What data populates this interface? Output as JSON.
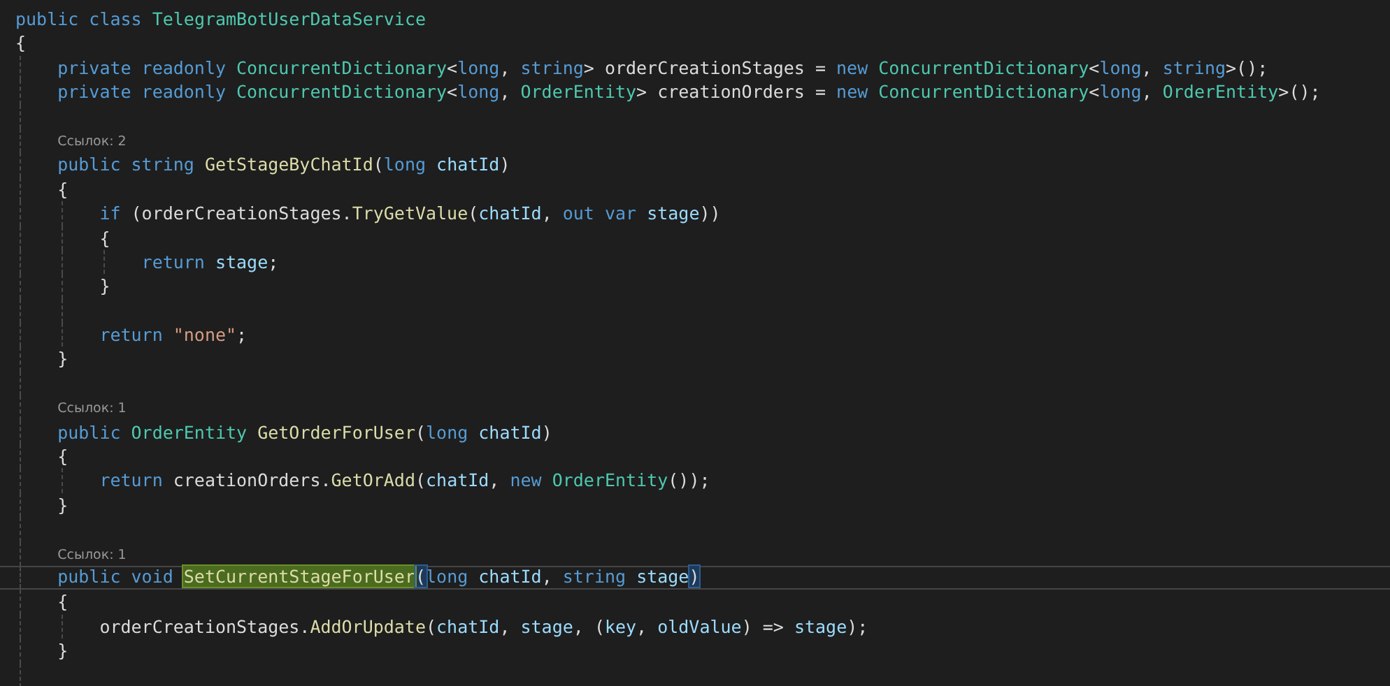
{
  "editor": {
    "lines": [
      {
        "kind": "code",
        "current": false,
        "tokens": [
          {
            "kind": "keyword",
            "text": "public class "
          },
          {
            "kind": "type",
            "text": "TelegramBotUserDataService"
          }
        ]
      },
      {
        "kind": "code",
        "current": false,
        "tokens": [
          {
            "kind": "plain",
            "text": "{"
          }
        ],
        "children": [
          {
            "kind": "code",
            "current": false,
            "tokens": [
              {
                "kind": "keyword",
                "text": "private readonly "
              },
              {
                "kind": "type",
                "text": "ConcurrentDictionary"
              },
              {
                "kind": "plain",
                "text": "<"
              },
              {
                "kind": "keyword",
                "text": "long"
              },
              {
                "kind": "plain",
                "text": ", "
              },
              {
                "kind": "keyword",
                "text": "string"
              },
              {
                "kind": "plain",
                "text": "> orderCreationStages = "
              },
              {
                "kind": "keyword",
                "text": "new "
              },
              {
                "kind": "type",
                "text": "ConcurrentDictionary"
              },
              {
                "kind": "plain",
                "text": "<"
              },
              {
                "kind": "keyword",
                "text": "long"
              },
              {
                "kind": "plain",
                "text": ", "
              },
              {
                "kind": "keyword",
                "text": "string"
              },
              {
                "kind": "plain",
                "text": ">();"
              }
            ]
          },
          {
            "kind": "code",
            "current": false,
            "tokens": [
              {
                "kind": "keyword",
                "text": "private readonly "
              },
              {
                "kind": "type",
                "text": "ConcurrentDictionary"
              },
              {
                "kind": "plain",
                "text": "<"
              },
              {
                "kind": "keyword",
                "text": "long"
              },
              {
                "kind": "plain",
                "text": ", "
              },
              {
                "kind": "type",
                "text": "OrderEntity"
              },
              {
                "kind": "plain",
                "text": "> creationOrders = "
              },
              {
                "kind": "keyword",
                "text": "new "
              },
              {
                "kind": "type",
                "text": "ConcurrentDictionary"
              },
              {
                "kind": "plain",
                "text": "<"
              },
              {
                "kind": "keyword",
                "text": "long"
              },
              {
                "kind": "plain",
                "text": ", "
              },
              {
                "kind": "type",
                "text": "OrderEntity"
              },
              {
                "kind": "plain",
                "text": ">();"
              }
            ]
          },
          {
            "kind": "blank"
          },
          {
            "kind": "codelens",
            "text": "Ссылок: 2"
          },
          {
            "kind": "code",
            "current": false,
            "tokens": [
              {
                "kind": "keyword",
                "text": "public string "
              },
              {
                "kind": "method",
                "text": "GetStageByChatId"
              },
              {
                "kind": "plain",
                "text": "("
              },
              {
                "kind": "keyword",
                "text": "long "
              },
              {
                "kind": "param",
                "text": "chatId"
              },
              {
                "kind": "plain",
                "text": ")"
              }
            ]
          },
          {
            "kind": "code",
            "current": false,
            "tokens": [
              {
                "kind": "plain",
                "text": "{"
              }
            ],
            "children": [
              {
                "kind": "code",
                "current": false,
                "tokens": [
                  {
                    "kind": "keyword",
                    "text": "if"
                  },
                  {
                    "kind": "plain",
                    "text": " (orderCreationStages."
                  },
                  {
                    "kind": "method",
                    "text": "TryGetValue"
                  },
                  {
                    "kind": "plain",
                    "text": "("
                  },
                  {
                    "kind": "param",
                    "text": "chatId"
                  },
                  {
                    "kind": "plain",
                    "text": ", "
                  },
                  {
                    "kind": "keyword",
                    "text": "out var "
                  },
                  {
                    "kind": "param",
                    "text": "stage"
                  },
                  {
                    "kind": "plain",
                    "text": "))"
                  }
                ]
              },
              {
                "kind": "code",
                "current": false,
                "tokens": [
                  {
                    "kind": "plain",
                    "text": "{"
                  }
                ],
                "children": [
                  {
                    "kind": "code",
                    "current": false,
                    "tokens": [
                      {
                        "kind": "keyword",
                        "text": "return "
                      },
                      {
                        "kind": "param",
                        "text": "stage"
                      },
                      {
                        "kind": "plain",
                        "text": ";"
                      }
                    ]
                  }
                ]
              },
              {
                "kind": "code",
                "current": false,
                "tokens": [
                  {
                    "kind": "plain",
                    "text": "}"
                  }
                ]
              },
              {
                "kind": "blank"
              },
              {
                "kind": "code",
                "current": false,
                "tokens": [
                  {
                    "kind": "keyword",
                    "text": "return "
                  },
                  {
                    "kind": "string",
                    "text": "\"none\""
                  },
                  {
                    "kind": "plain",
                    "text": ";"
                  }
                ]
              }
            ]
          },
          {
            "kind": "code",
            "current": false,
            "tokens": [
              {
                "kind": "plain",
                "text": "}"
              }
            ]
          },
          {
            "kind": "blank"
          },
          {
            "kind": "codelens",
            "text": "Ссылок: 1"
          },
          {
            "kind": "code",
            "current": false,
            "tokens": [
              {
                "kind": "keyword",
                "text": "public "
              },
              {
                "kind": "type",
                "text": "OrderEntity "
              },
              {
                "kind": "method",
                "text": "GetOrderForUser"
              },
              {
                "kind": "plain",
                "text": "("
              },
              {
                "kind": "keyword",
                "text": "long "
              },
              {
                "kind": "param",
                "text": "chatId"
              },
              {
                "kind": "plain",
                "text": ")"
              }
            ]
          },
          {
            "kind": "code",
            "current": false,
            "tokens": [
              {
                "kind": "plain",
                "text": "{"
              }
            ],
            "children": [
              {
                "kind": "code",
                "current": false,
                "tokens": [
                  {
                    "kind": "keyword",
                    "text": "return "
                  },
                  {
                    "kind": "plain",
                    "text": "creationOrders."
                  },
                  {
                    "kind": "method",
                    "text": "GetOrAdd"
                  },
                  {
                    "kind": "plain",
                    "text": "("
                  },
                  {
                    "kind": "param",
                    "text": "chatId"
                  },
                  {
                    "kind": "plain",
                    "text": ", "
                  },
                  {
                    "kind": "keyword",
                    "text": "new "
                  },
                  {
                    "kind": "type",
                    "text": "OrderEntity"
                  },
                  {
                    "kind": "plain",
                    "text": "());"
                  }
                ]
              }
            ]
          },
          {
            "kind": "code",
            "current": false,
            "tokens": [
              {
                "kind": "plain",
                "text": "}"
              }
            ]
          },
          {
            "kind": "blank"
          },
          {
            "kind": "codelens",
            "text": "Ссылок: 1"
          },
          {
            "kind": "code",
            "current": true,
            "tokens": [
              {
                "kind": "keyword",
                "text": "public void "
              },
              {
                "kind": "method-highlight",
                "text": "SetCurrentStageForUser"
              },
              {
                "kind": "brace-match",
                "text": "("
              },
              {
                "kind": "keyword",
                "text": "long "
              },
              {
                "kind": "param",
                "text": "chatId"
              },
              {
                "kind": "plain",
                "text": ", "
              },
              {
                "kind": "keyword",
                "text": "string "
              },
              {
                "kind": "param",
                "text": "stage"
              },
              {
                "kind": "brace-match",
                "text": ")"
              }
            ]
          },
          {
            "kind": "code",
            "current": false,
            "tokens": [
              {
                "kind": "plain",
                "text": "{"
              }
            ],
            "children": [
              {
                "kind": "code",
                "current": false,
                "tokens": [
                  {
                    "kind": "plain",
                    "text": "orderCreationStages."
                  },
                  {
                    "kind": "method",
                    "text": "AddOrUpdate"
                  },
                  {
                    "kind": "plain",
                    "text": "("
                  },
                  {
                    "kind": "param",
                    "text": "chatId"
                  },
                  {
                    "kind": "plain",
                    "text": ", "
                  },
                  {
                    "kind": "param",
                    "text": "stage"
                  },
                  {
                    "kind": "plain",
                    "text": ", ("
                  },
                  {
                    "kind": "param",
                    "text": "key"
                  },
                  {
                    "kind": "plain",
                    "text": ", "
                  },
                  {
                    "kind": "param",
                    "text": "oldValue"
                  },
                  {
                    "kind": "plain",
                    "text": ") => "
                  },
                  {
                    "kind": "param",
                    "text": "stage"
                  },
                  {
                    "kind": "plain",
                    "text": ");"
                  }
                ]
              }
            ]
          },
          {
            "kind": "code",
            "current": false,
            "tokens": [
              {
                "kind": "plain",
                "text": "}"
              }
            ]
          },
          {
            "kind": "blank"
          }
        ]
      }
    ]
  }
}
